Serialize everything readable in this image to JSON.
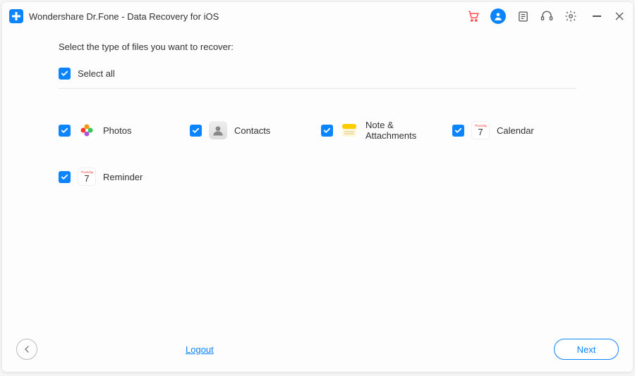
{
  "titlebar": {
    "app_title": "Wondershare Dr.Fone - Data Recovery for iOS"
  },
  "main": {
    "instruction": "Select the type of files you want to recover:",
    "select_all_label": "Select all",
    "items": [
      {
        "label": "Photos",
        "icon": "photos-icon"
      },
      {
        "label": "Contacts",
        "icon": "contacts-icon"
      },
      {
        "label": "Note & Attachments",
        "icon": "notes-icon"
      },
      {
        "label": "Calendar",
        "icon": "calendar-icon",
        "day": "Thursday",
        "num": "7"
      },
      {
        "label": "Reminder",
        "icon": "reminder-icon",
        "day": "Thursday",
        "num": "7"
      }
    ]
  },
  "footer": {
    "logout_label": "Logout",
    "next_label": "Next"
  }
}
